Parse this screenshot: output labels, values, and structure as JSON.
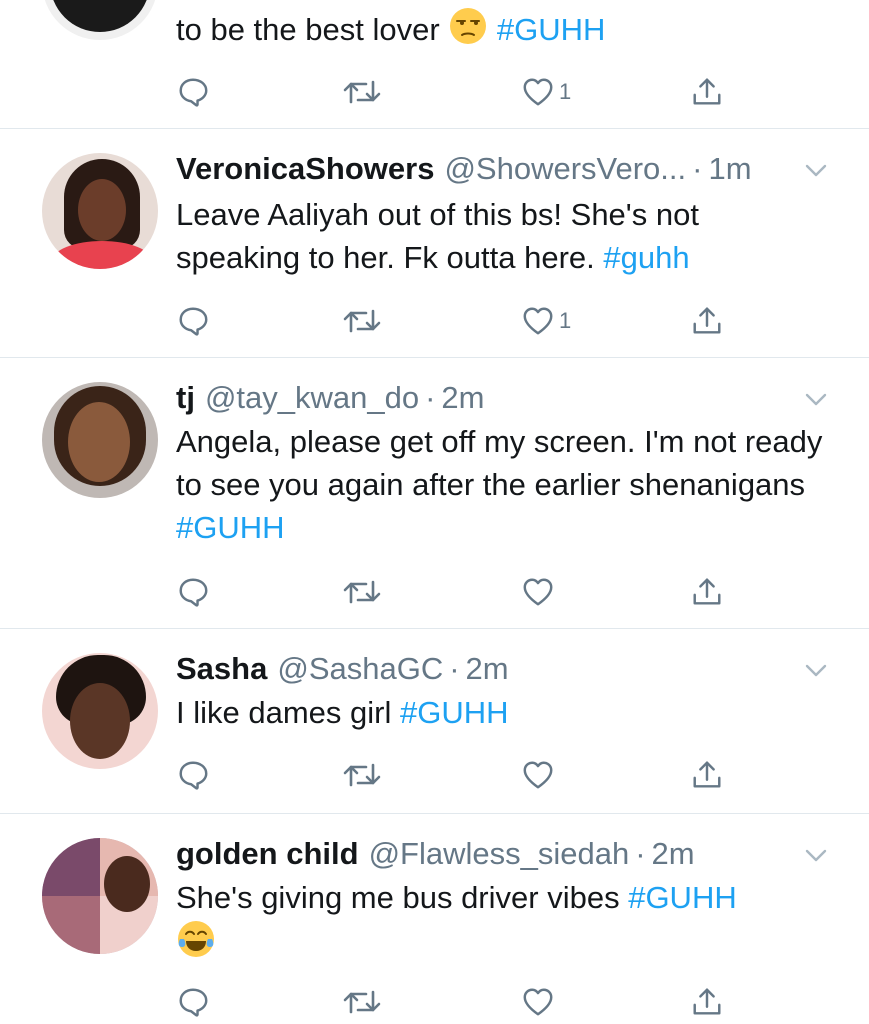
{
  "tweets": [
    {
      "text": "to be the best lover",
      "emoji": "unamused-face",
      "hashtag": "#GUHH",
      "likes": "1"
    },
    {
      "name": "VeronicaShowers",
      "handle": "@ShowersVero...",
      "sep": "·",
      "time": "1m",
      "text": "Leave Aaliyah out of this bs! She's not speaking to her. Fk outta here.",
      "hashtag": "#guhh",
      "likes": "1"
    },
    {
      "name": "tj",
      "handle": "@tay_kwan_do",
      "sep": "·",
      "time": "2m",
      "text": "Angela, please get off my screen. I'm not ready to see you again after the earlier shenanigans",
      "hashtag": "#GUHH",
      "likes": ""
    },
    {
      "name": "Sasha",
      "handle": "@SashaGC",
      "sep": "·",
      "time": "2m",
      "text": "I like dames girl",
      "hashtag": "#GUHH",
      "likes": ""
    },
    {
      "name": "golden child",
      "handle": "@Flawless_siedah",
      "sep": "·",
      "time": "2m",
      "text": "She's giving me bus driver vibes",
      "hashtag": "#GUHH",
      "emoji": "face-with-tears-of-joy",
      "likes": ""
    }
  ],
  "icons": {
    "reply": "reply-icon",
    "retweet": "retweet-icon",
    "like": "heart-icon",
    "share": "share-icon",
    "caret": "chevron-down-icon"
  },
  "colors": {
    "hashtag": "#1da1f2",
    "secondary": "#657786",
    "divider": "#e1e8ed"
  }
}
